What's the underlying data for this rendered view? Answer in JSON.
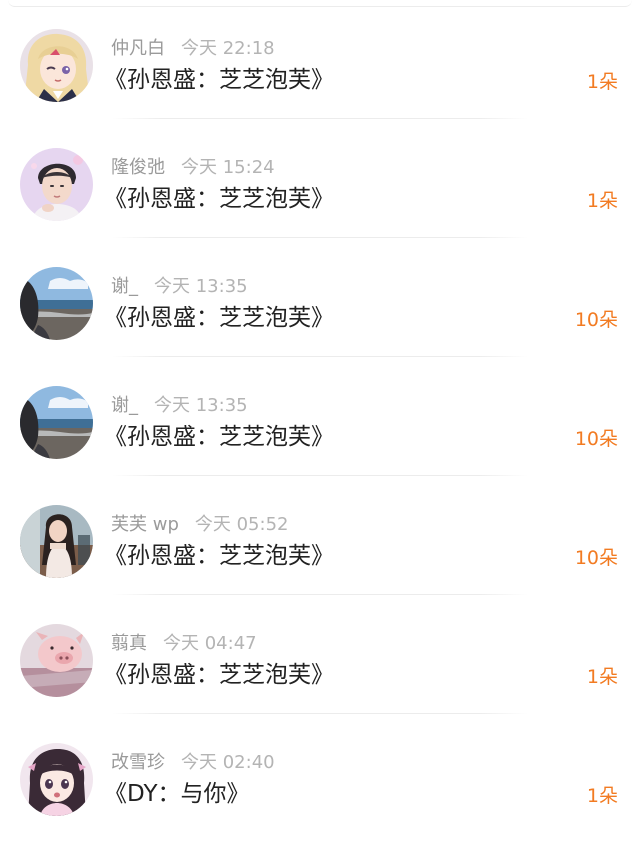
{
  "items": [
    {
      "name": "仲凡白",
      "time": "今天 22:18",
      "title": "《孙恩盛：芝芝泡芙》",
      "count": "1朵",
      "avatar": "anime-girl-blonde-avatar"
    },
    {
      "name": "隆俊弛",
      "time": "今天 15:24",
      "title": "《孙恩盛：芝芝泡芙》",
      "count": "1朵",
      "avatar": "young-man-photo-avatar"
    },
    {
      "name": "谢_",
      "time": "今天 13:35",
      "title": "《孙恩盛：芝芝泡芙》",
      "count": "10朵",
      "avatar": "seaside-photo-avatar"
    },
    {
      "name": "谢_",
      "time": "今天 13:35",
      "title": "《孙恩盛：芝芝泡芙》",
      "count": "10朵",
      "avatar": "seaside-photo-avatar"
    },
    {
      "name": "芙芙 wp",
      "time": "今天 05:52",
      "title": "《孙恩盛：芝芝泡芙》",
      "count": "10朵",
      "avatar": "girl-photo-avatar"
    },
    {
      "name": "翦真",
      "time": "今天 04:47",
      "title": "《孙恩盛：芝芝泡芙》",
      "count": "1朵",
      "avatar": "pig-photo-avatar"
    },
    {
      "name": "改雪珍",
      "time": "今天 02:40",
      "title": "《DY：与你》",
      "count": "1朵",
      "avatar": "anime-girl-dark-hair-avatar"
    }
  ],
  "colors": {
    "count": "#f27b22",
    "title": "#222222",
    "meta": "#a7a7a7",
    "divider": "#ececec"
  }
}
